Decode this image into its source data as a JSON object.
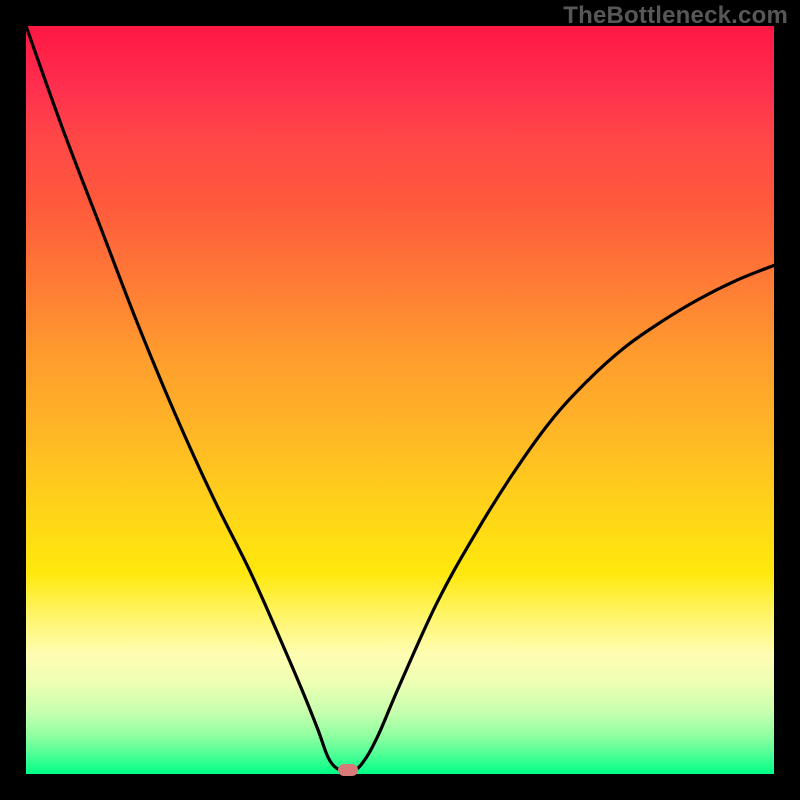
{
  "watermark": "TheBottleneck.com",
  "chart_data": {
    "type": "line",
    "title": "",
    "xlabel": "",
    "ylabel": "",
    "xlim": [
      0,
      100
    ],
    "ylim": [
      0,
      100
    ],
    "series": [
      {
        "name": "bottleneck-curve",
        "x": [
          0,
          5,
          10,
          15,
          20,
          25,
          30,
          34,
          37,
          39,
          40.5,
          42,
          43.5,
          45,
          47,
          50,
          55,
          60,
          65,
          70,
          75,
          80,
          85,
          90,
          95,
          100
        ],
        "values": [
          100,
          86,
          73,
          60,
          48,
          37,
          27,
          18,
          11,
          6,
          2,
          0.5,
          0.3,
          1.5,
          5,
          12,
          23,
          32,
          40,
          47,
          52.5,
          57,
          60.5,
          63.5,
          66,
          68
        ]
      }
    ],
    "marker": {
      "x": 43,
      "y": 0.5,
      "label": "optimal-point"
    },
    "gradient": {
      "top": "#ff1744",
      "mid": "#ffd21a",
      "bottom": "#00ff88"
    }
  }
}
